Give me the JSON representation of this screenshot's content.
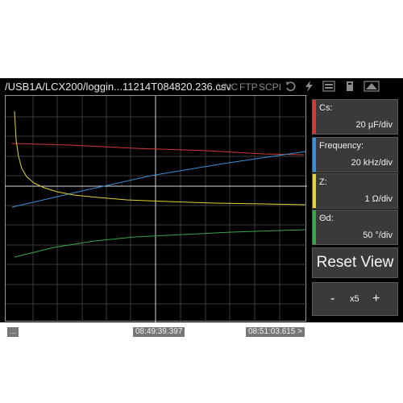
{
  "window": {
    "path": "/USB1A/LCX200/loggin...11214T084820.236.csv",
    "status_items": [
      "VNC",
      "FTP",
      "SCPI"
    ]
  },
  "plot": {
    "time_start": "08:49:39.397",
    "time_end": "08:51:03.615 >",
    "menu_label": "...",
    "grid": true,
    "traces": [
      {
        "name": "Cs",
        "color": "#d13a3a"
      },
      {
        "name": "Frequency",
        "color": "#3a8fd6"
      },
      {
        "name": "Z",
        "color": "#e2d23a"
      },
      {
        "name": "Θd",
        "color": "#3aa64a"
      }
    ]
  },
  "panel": {
    "cards": [
      {
        "label": "Cs:",
        "value": "20 µF/div",
        "color": "#d13a3a"
      },
      {
        "label": "Frequency:",
        "value": "20 kHz/div",
        "color": "#3a8fd6"
      },
      {
        "label": "Z:",
        "value": "1 Ω/div",
        "color": "#e2d23a"
      },
      {
        "label": "Θd:",
        "value": "50 °/div",
        "color": "#3aa64a"
      }
    ],
    "reset_label": "Reset View",
    "zoom": {
      "minus": "-",
      "factor": "x5",
      "plus": "+"
    }
  }
}
